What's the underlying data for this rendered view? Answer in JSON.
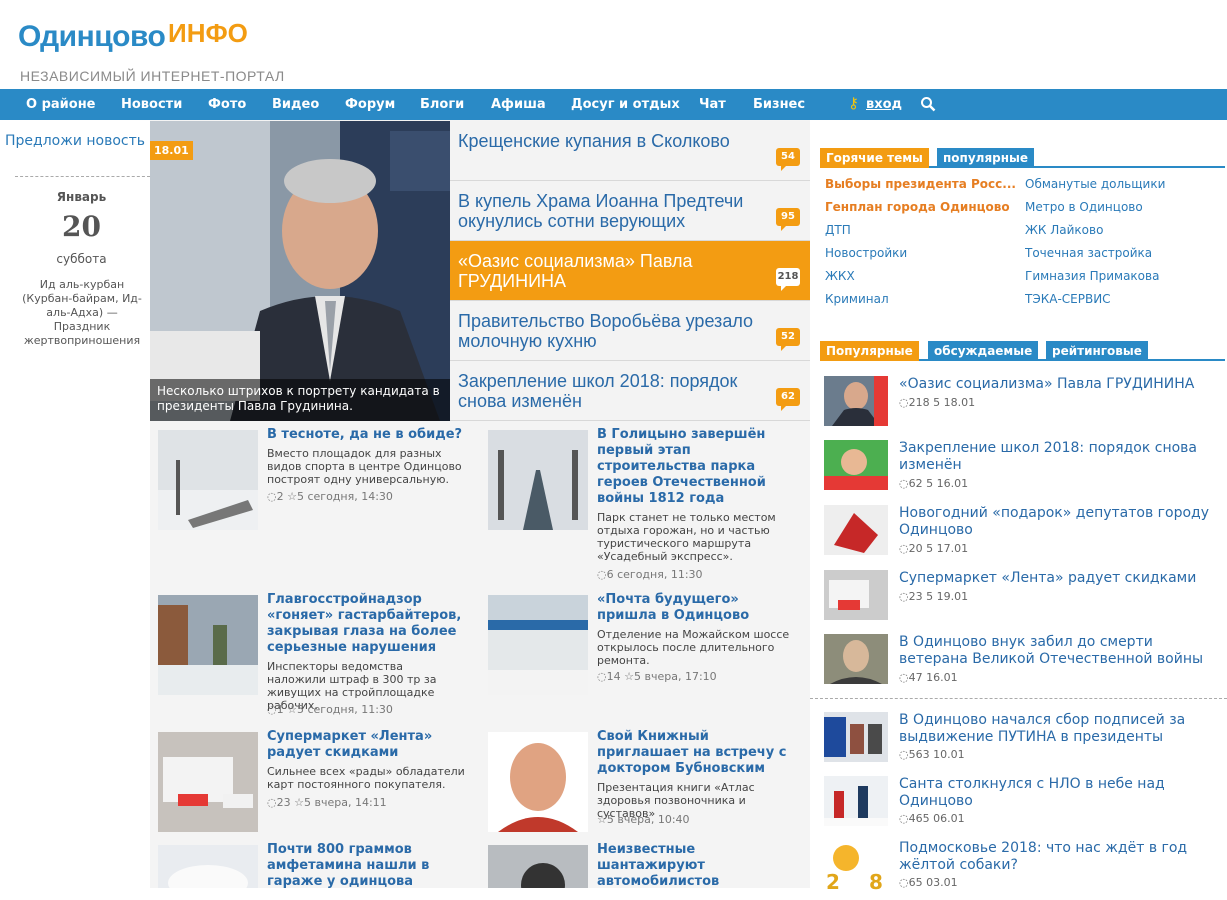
{
  "header": {
    "logo_main": "Одинцово",
    "logo_info": "ИНФО",
    "tagline": "НЕЗАВИСИМЫЙ  ИНТЕРНЕТ-ПОРТАЛ"
  },
  "nav": {
    "items": [
      "О районе",
      "Новости",
      "Фото",
      "Видео",
      "Форум",
      "Блоги",
      "Афиша",
      "Досуг и отдых",
      "Чат",
      "Бизнес"
    ],
    "login": "вход"
  },
  "left": {
    "suggest": "Предложи новость",
    "month": "Январь",
    "day": "20",
    "weekday": "суббота",
    "holiday": "Ид аль-курбан (Курбан-байрам, Ид-аль-Адха) — Праздник жертвоприношения"
  },
  "hero": {
    "date": "18.01",
    "caption": "Несколько штрихов к портрету кандидата в президенты Павла Грудинина."
  },
  "tops": [
    {
      "title": "Крещенские купания в Сколково",
      "count": "54"
    },
    {
      "title": "В купель Храма Иоанна Предтечи окунулись сотни верующих",
      "count": "95"
    },
    {
      "title": "«Оазис социализма» Павла ГРУДИНИНА",
      "count": "218"
    },
    {
      "title": "Правительство Воробьёва урезало молочную кухню",
      "count": "52"
    },
    {
      "title": "Закрепление школ 2018: порядок снова изменён",
      "count": "62"
    }
  ],
  "news_left": [
    {
      "title": "В тесноте, да не в обиде?",
      "desc": "Вместо площадок для разных видов спорта в центре Одинцово построят одну универсальную.",
      "comments": "2",
      "rating": "5",
      "time": "сегодня, 14:30"
    },
    {
      "title": "Главгосстройнадзор «гоняет» гастарбайтеров, закрывая глаза на более серьезные нарушения",
      "desc": "Инспекторы ведомства наложили штраф в 300 тр за живущих на стройплощадке рабочих.",
      "comments": "1",
      "rating": "5",
      "time": "сегодня, 11:30"
    },
    {
      "title": "Супермаркет «Лента» радует скидками",
      "desc": "Сильнее всех «рады» обладатели карт постоянного покупателя.",
      "comments": "23",
      "rating": "5",
      "time": "вчера, 14:11"
    },
    {
      "title": "Почти 800 граммов амфетамина нашли в гараже у одинцова",
      "desc": "",
      "comments": "",
      "rating": "",
      "time": ""
    }
  ],
  "news_right": [
    {
      "title": "В Голицыно завершён первый этап строительства парка героев Отечественной войны 1812 года",
      "desc": "Парк станет не только местом отдыха горожан, но и частью туристического маршрута «Усадебный экспресс».",
      "comments": "6",
      "rating": "",
      "time": "сегодня, 11:30"
    },
    {
      "title": "«Почта будущего» пришла в Одинцово",
      "desc": "Отделение на Можайском шоссе открылось после длительного ремонта.",
      "comments": "14",
      "rating": "5",
      "time": "вчера, 17:10"
    },
    {
      "title": "Свой Книжный приглашает на встречу с доктором Бубновским",
      "desc": "Презентация книги «Атлас здоровья позвоночника и суставов»",
      "comments": "",
      "rating": "5",
      "time": "вчера, 10:40"
    },
    {
      "title": "Неизвестные шантажируют автомобилистов",
      "desc": "",
      "comments": "",
      "rating": "",
      "time": ""
    }
  ],
  "right": {
    "tabs1": [
      "Горячие темы",
      "популярные"
    ],
    "hot_left": [
      "Выборы президента Росс...",
      "Генплан города Одинцово",
      "ДТП",
      "Новостройки",
      "ЖКХ",
      "Криминал"
    ],
    "hot_right": [
      "Обманутые дольщики",
      "Метро в Одинцово",
      "ЖК Лайково",
      "Точечная застройка",
      "Гимназия Примакова",
      "ТЭКА-СЕРВИС"
    ],
    "tabs2": [
      "Популярные",
      "обсуждаемые",
      "рейтинговые"
    ],
    "popular": [
      {
        "title": "«Оазис социализма» Павла ГРУДИНИНА",
        "meta": "218  5  18.01"
      },
      {
        "title": "Закрепление школ 2018: порядок снова изменён",
        "meta": "62  5  16.01"
      },
      {
        "title": "Новогодний «подарок» депутатов городу Одинцово",
        "meta": "20  5  17.01"
      },
      {
        "title": "Супермаркет «Лента» радует скидками",
        "meta": "23  5  19.01"
      },
      {
        "title": "В Одинцово внук забил до смерти ветерана Великой Отечественной войны",
        "meta": "47  16.01"
      }
    ],
    "more": [
      {
        "title": "В Одинцово начался сбор подписей за выдвижение ПУТИНА в президенты",
        "meta": "563  10.01"
      },
      {
        "title": "Санта столкнулся с НЛО в небе над Одинцово",
        "meta": "465  06.01"
      },
      {
        "title": "Подмосковье 2018: что нас ждёт в год жёлтой собаки?",
        "meta": "65  03.01"
      }
    ]
  },
  "colors": {
    "brand_blue": "#2a8ac6",
    "accent_orange": "#f39c12",
    "link": "#2a6aa8"
  }
}
